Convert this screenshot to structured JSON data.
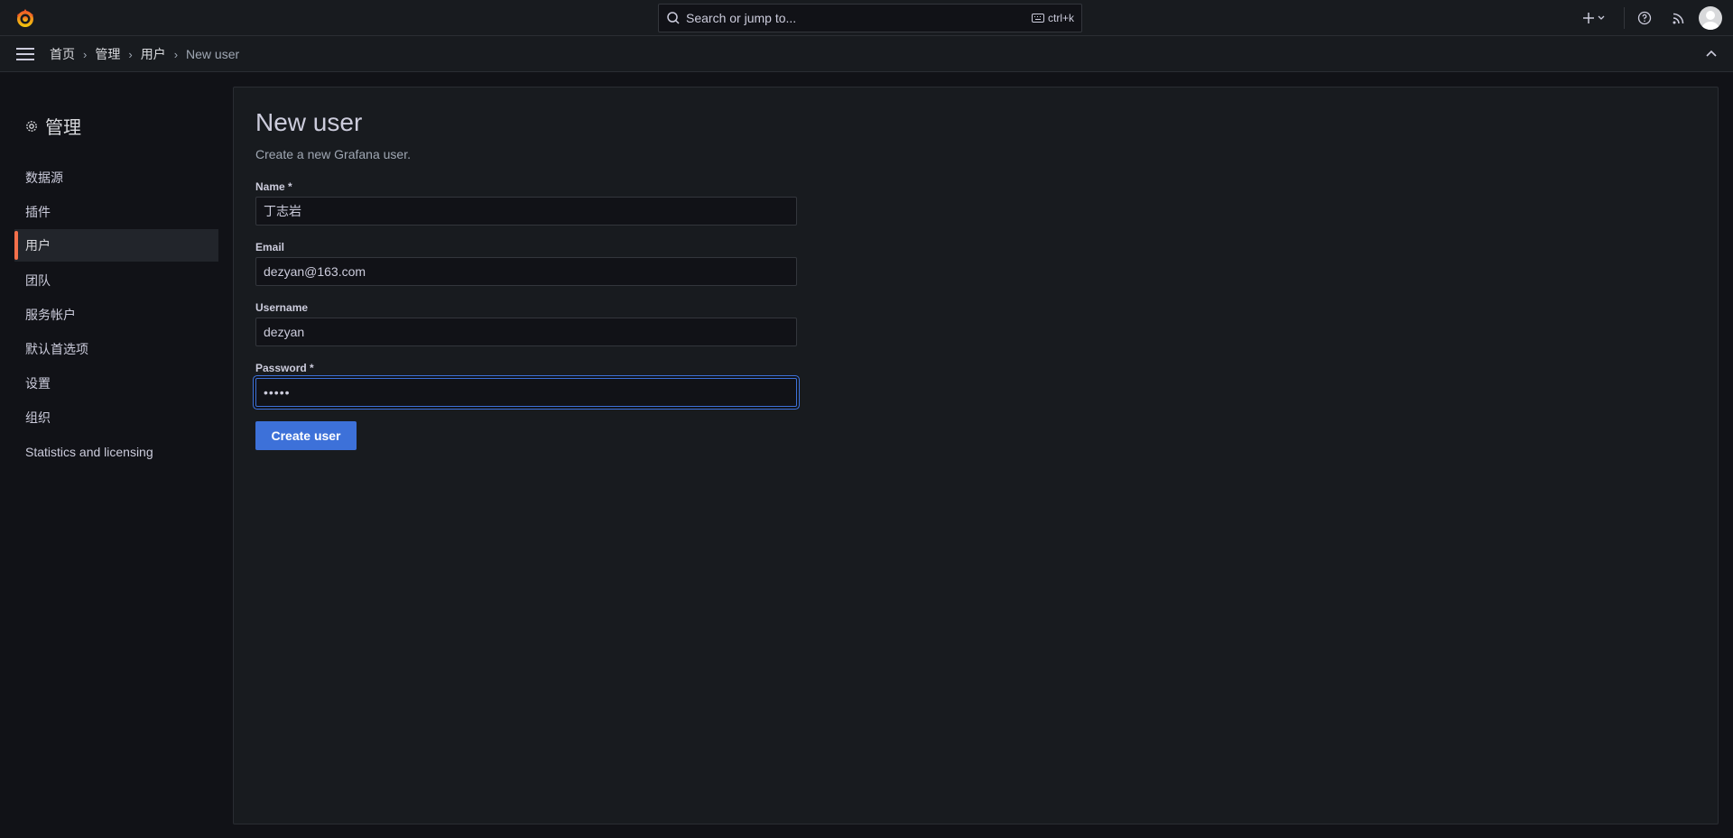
{
  "topbar": {
    "search_placeholder": "Search or jump to...",
    "search_shortcut": "ctrl+k"
  },
  "breadcrumb": {
    "items": [
      "首页",
      "管理",
      "用户"
    ],
    "current": "New user"
  },
  "sidebar": {
    "title": "管理",
    "items": [
      {
        "label": "数据源"
      },
      {
        "label": "插件"
      },
      {
        "label": "用户"
      },
      {
        "label": "团队"
      },
      {
        "label": "服务帐户"
      },
      {
        "label": "默认首选项"
      },
      {
        "label": "设置"
      },
      {
        "label": "组织"
      },
      {
        "label": "Statistics and licensing"
      }
    ],
    "active_item": "用户"
  },
  "form": {
    "title": "New user",
    "subtitle": "Create a new Grafana user.",
    "name_label": "Name *",
    "name_value": "丁志岩",
    "email_label": "Email",
    "email_value": "dezyan@163.com",
    "username_label": "Username",
    "username_value": "dezyan",
    "password_label": "Password *",
    "password_value": "•••••",
    "submit_label": "Create user"
  },
  "colors": {
    "accent": "#3d71d9",
    "active_indicator": "#f5704b",
    "background": "#111217",
    "panel": "#181b1f"
  }
}
